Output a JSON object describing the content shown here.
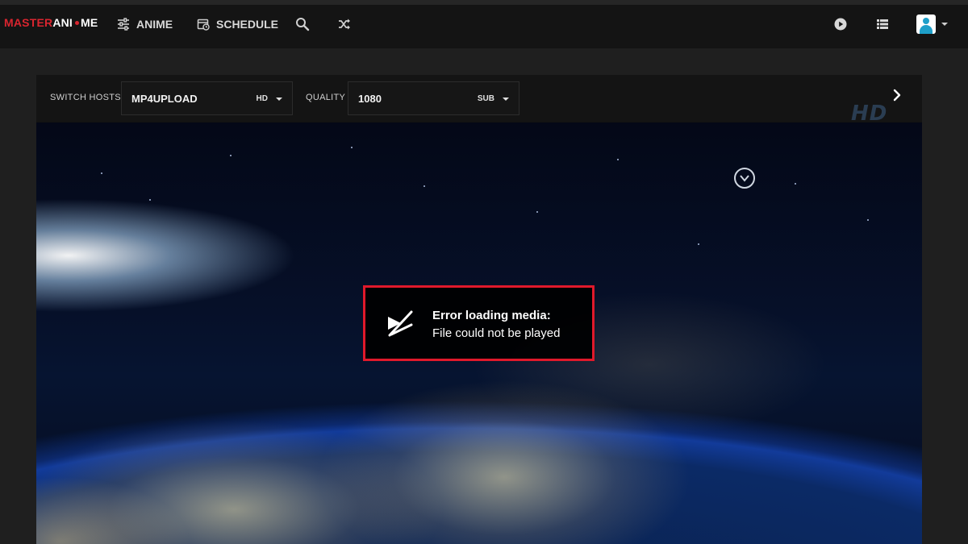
{
  "header": {
    "logo": {
      "part1": "MASTER",
      "part2": "ANI",
      "part3": "ME"
    },
    "nav": [
      {
        "label": "ANIME",
        "icon": "sliders-icon"
      },
      {
        "label": "SCHEDULE",
        "icon": "calendar-icon"
      }
    ],
    "icons": [
      "search-icon",
      "shuffle-icon",
      "play-circle-icon",
      "list-icon",
      "user-avatar",
      "chevron-down-icon"
    ]
  },
  "player": {
    "hosts_label": "SWITCH HOSTS",
    "host_value": "MP4UPLOAD",
    "host_tag": "HD",
    "quality_label": "QUALITY",
    "quality_value": "1080",
    "quality_tag": "SUB",
    "hd_badge": "HD",
    "error_title": "Error loading media:",
    "error_message": "File could not be played"
  },
  "colors": {
    "brand_red": "#d9252f",
    "error_border": "#e0192b",
    "navbar_bg": "#141414",
    "page_bg": "#1f1f1f"
  }
}
